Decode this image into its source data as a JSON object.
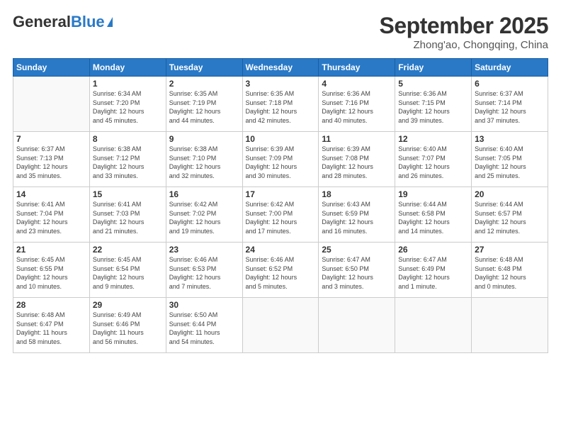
{
  "header": {
    "logo_general": "General",
    "logo_blue": "Blue",
    "title": "September 2025",
    "subtitle": "Zhong'ao, Chongqing, China"
  },
  "calendar": {
    "days_of_week": [
      "Sunday",
      "Monday",
      "Tuesday",
      "Wednesday",
      "Thursday",
      "Friday",
      "Saturday"
    ],
    "weeks": [
      [
        {
          "day": "",
          "info": ""
        },
        {
          "day": "1",
          "info": "Sunrise: 6:34 AM\nSunset: 7:20 PM\nDaylight: 12 hours\nand 45 minutes."
        },
        {
          "day": "2",
          "info": "Sunrise: 6:35 AM\nSunset: 7:19 PM\nDaylight: 12 hours\nand 44 minutes."
        },
        {
          "day": "3",
          "info": "Sunrise: 6:35 AM\nSunset: 7:18 PM\nDaylight: 12 hours\nand 42 minutes."
        },
        {
          "day": "4",
          "info": "Sunrise: 6:36 AM\nSunset: 7:16 PM\nDaylight: 12 hours\nand 40 minutes."
        },
        {
          "day": "5",
          "info": "Sunrise: 6:36 AM\nSunset: 7:15 PM\nDaylight: 12 hours\nand 39 minutes."
        },
        {
          "day": "6",
          "info": "Sunrise: 6:37 AM\nSunset: 7:14 PM\nDaylight: 12 hours\nand 37 minutes."
        }
      ],
      [
        {
          "day": "7",
          "info": "Sunrise: 6:37 AM\nSunset: 7:13 PM\nDaylight: 12 hours\nand 35 minutes."
        },
        {
          "day": "8",
          "info": "Sunrise: 6:38 AM\nSunset: 7:12 PM\nDaylight: 12 hours\nand 33 minutes."
        },
        {
          "day": "9",
          "info": "Sunrise: 6:38 AM\nSunset: 7:10 PM\nDaylight: 12 hours\nand 32 minutes."
        },
        {
          "day": "10",
          "info": "Sunrise: 6:39 AM\nSunset: 7:09 PM\nDaylight: 12 hours\nand 30 minutes."
        },
        {
          "day": "11",
          "info": "Sunrise: 6:39 AM\nSunset: 7:08 PM\nDaylight: 12 hours\nand 28 minutes."
        },
        {
          "day": "12",
          "info": "Sunrise: 6:40 AM\nSunset: 7:07 PM\nDaylight: 12 hours\nand 26 minutes."
        },
        {
          "day": "13",
          "info": "Sunrise: 6:40 AM\nSunset: 7:05 PM\nDaylight: 12 hours\nand 25 minutes."
        }
      ],
      [
        {
          "day": "14",
          "info": "Sunrise: 6:41 AM\nSunset: 7:04 PM\nDaylight: 12 hours\nand 23 minutes."
        },
        {
          "day": "15",
          "info": "Sunrise: 6:41 AM\nSunset: 7:03 PM\nDaylight: 12 hours\nand 21 minutes."
        },
        {
          "day": "16",
          "info": "Sunrise: 6:42 AM\nSunset: 7:02 PM\nDaylight: 12 hours\nand 19 minutes."
        },
        {
          "day": "17",
          "info": "Sunrise: 6:42 AM\nSunset: 7:00 PM\nDaylight: 12 hours\nand 17 minutes."
        },
        {
          "day": "18",
          "info": "Sunrise: 6:43 AM\nSunset: 6:59 PM\nDaylight: 12 hours\nand 16 minutes."
        },
        {
          "day": "19",
          "info": "Sunrise: 6:44 AM\nSunset: 6:58 PM\nDaylight: 12 hours\nand 14 minutes."
        },
        {
          "day": "20",
          "info": "Sunrise: 6:44 AM\nSunset: 6:57 PM\nDaylight: 12 hours\nand 12 minutes."
        }
      ],
      [
        {
          "day": "21",
          "info": "Sunrise: 6:45 AM\nSunset: 6:55 PM\nDaylight: 12 hours\nand 10 minutes."
        },
        {
          "day": "22",
          "info": "Sunrise: 6:45 AM\nSunset: 6:54 PM\nDaylight: 12 hours\nand 9 minutes."
        },
        {
          "day": "23",
          "info": "Sunrise: 6:46 AM\nSunset: 6:53 PM\nDaylight: 12 hours\nand 7 minutes."
        },
        {
          "day": "24",
          "info": "Sunrise: 6:46 AM\nSunset: 6:52 PM\nDaylight: 12 hours\nand 5 minutes."
        },
        {
          "day": "25",
          "info": "Sunrise: 6:47 AM\nSunset: 6:50 PM\nDaylight: 12 hours\nand 3 minutes."
        },
        {
          "day": "26",
          "info": "Sunrise: 6:47 AM\nSunset: 6:49 PM\nDaylight: 12 hours\nand 1 minute."
        },
        {
          "day": "27",
          "info": "Sunrise: 6:48 AM\nSunset: 6:48 PM\nDaylight: 12 hours\nand 0 minutes."
        }
      ],
      [
        {
          "day": "28",
          "info": "Sunrise: 6:48 AM\nSunset: 6:47 PM\nDaylight: 11 hours\nand 58 minutes."
        },
        {
          "day": "29",
          "info": "Sunrise: 6:49 AM\nSunset: 6:46 PM\nDaylight: 11 hours\nand 56 minutes."
        },
        {
          "day": "30",
          "info": "Sunrise: 6:50 AM\nSunset: 6:44 PM\nDaylight: 11 hours\nand 54 minutes."
        },
        {
          "day": "",
          "info": ""
        },
        {
          "day": "",
          "info": ""
        },
        {
          "day": "",
          "info": ""
        },
        {
          "day": "",
          "info": ""
        }
      ]
    ]
  }
}
